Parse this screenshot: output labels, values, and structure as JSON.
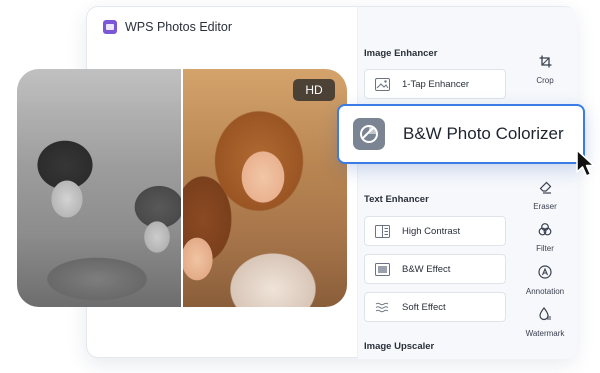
{
  "app": {
    "title": "WPS Photos Editor"
  },
  "photo": {
    "badge": "HD"
  },
  "panel": {
    "image_enhancer": {
      "title": "Image Enhancer",
      "items": [
        {
          "label": "1-Tap Enhancer",
          "icon": "image-enhance-icon"
        }
      ]
    },
    "text_enhancer": {
      "title": "Text Enhancer",
      "items": [
        {
          "label": "High Contrast",
          "icon": "contrast-icon"
        },
        {
          "label": "B&W Effect",
          "icon": "bw-effect-icon"
        },
        {
          "label": "Soft Effect",
          "icon": "soft-effect-icon"
        }
      ]
    },
    "image_upscaler": {
      "title": "Image Upscaler"
    }
  },
  "sidebar": {
    "items": [
      {
        "label": "Crop",
        "icon": "crop-icon"
      },
      {
        "label": "Eraser",
        "icon": "eraser-icon"
      },
      {
        "label": "Filter",
        "icon": "filter-icon"
      },
      {
        "label": "Annotation",
        "icon": "annotation-icon"
      },
      {
        "label": "Watermark",
        "icon": "watermark-icon"
      }
    ]
  },
  "popout": {
    "label": "B&W Photo Colorizer",
    "icon": "colorizer-icon"
  },
  "colors": {
    "accent": "#3a7be6",
    "logo": "#7a57d6"
  }
}
